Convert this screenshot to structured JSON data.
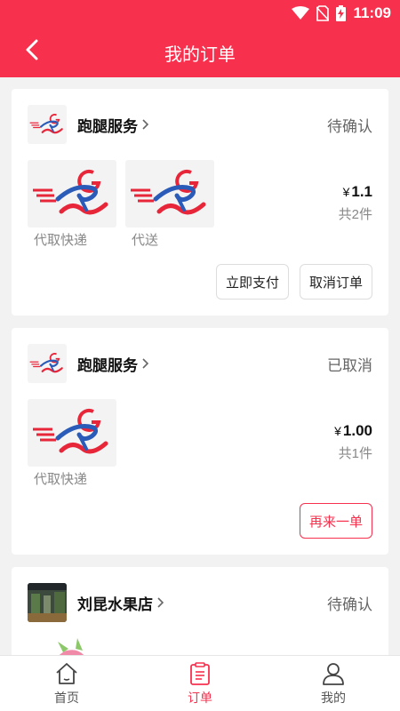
{
  "status_bar": {
    "time": "11:09"
  },
  "header": {
    "title": "我的订单"
  },
  "orders": [
    {
      "shop": "跑腿服务",
      "status": "待确认",
      "goods": [
        {
          "name": "代取快递"
        },
        {
          "name": "代送"
        }
      ],
      "currency": "¥",
      "price": "1.1",
      "count": "共2件",
      "actions": [
        "立即支付",
        "取消订单"
      ]
    },
    {
      "shop": "跑腿服务",
      "status": "已取消",
      "goods": [
        {
          "name": "代取快递"
        }
      ],
      "currency": "¥",
      "price": "1.00",
      "count": "共1件",
      "actions": [
        "再来一单"
      ]
    },
    {
      "shop": "刘昆水果店",
      "status": "待确认"
    }
  ],
  "tabs": [
    {
      "label": "首页",
      "icon": "home-icon"
    },
    {
      "label": "订单",
      "icon": "order-icon",
      "active": true
    },
    {
      "label": "我的",
      "icon": "user-icon"
    }
  ],
  "colors": {
    "accent": "#f7304e",
    "logo_red": "#e8263a",
    "logo_blue": "#2a5bb8"
  }
}
